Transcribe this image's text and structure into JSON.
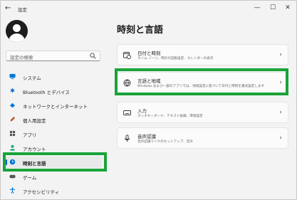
{
  "window": {
    "title": "設定",
    "back_icon": "back-arrow-icon",
    "controls": {
      "minimize": "—",
      "maximize": "☐",
      "close": "✕"
    }
  },
  "sidebar": {
    "search_placeholder": "設定の検索",
    "items": [
      {
        "label": "システム",
        "icon": "monitor-icon",
        "color": "#0078d4"
      },
      {
        "label": "Bluetooth とデバイス",
        "icon": "bluetooth-icon",
        "color": "#0067c0"
      },
      {
        "label": "ネットワークとインターネット",
        "icon": "wifi-icon",
        "color": "#0078d4"
      },
      {
        "label": "個人用設定",
        "icon": "brush-icon",
        "color": "#c05a2d"
      },
      {
        "label": "アプリ",
        "icon": "apps-icon",
        "color": "#444444"
      },
      {
        "label": "アカウント",
        "icon": "person-icon",
        "color": "#1aa37a"
      },
      {
        "label": "時刻と言語",
        "icon": "globe-clock-icon",
        "color": "#0078d4",
        "active": true
      },
      {
        "label": "ゲーム",
        "icon": "gamepad-icon",
        "color": "#444444"
      },
      {
        "label": "アクセシビリティ",
        "icon": "accessibility-icon",
        "color": "#0078d4"
      }
    ]
  },
  "main": {
    "title": "時刻と言語",
    "cards": [
      {
        "title": "日付と時刻",
        "subtitle": "タイム ゾーン、時計の自動設定、カレンダーの表示",
        "icon": "calendar-clock-icon"
      },
      {
        "title": "言語と地域",
        "subtitle": "Windows および一部のアプリでは、地域設定に基づいて日付と時刻を書式設定します",
        "icon": "language-icon"
      },
      {
        "title": "入力",
        "subtitle": "タッチキーボード、テキスト候補、環境設定",
        "icon": "keyboard-icon"
      },
      {
        "title": "音声認識",
        "subtitle": "音声認識マイクのセットアップ、音声",
        "icon": "microphone-icon"
      }
    ]
  },
  "colors": {
    "highlight": "#1aa33a",
    "accent": "#0067c0"
  }
}
